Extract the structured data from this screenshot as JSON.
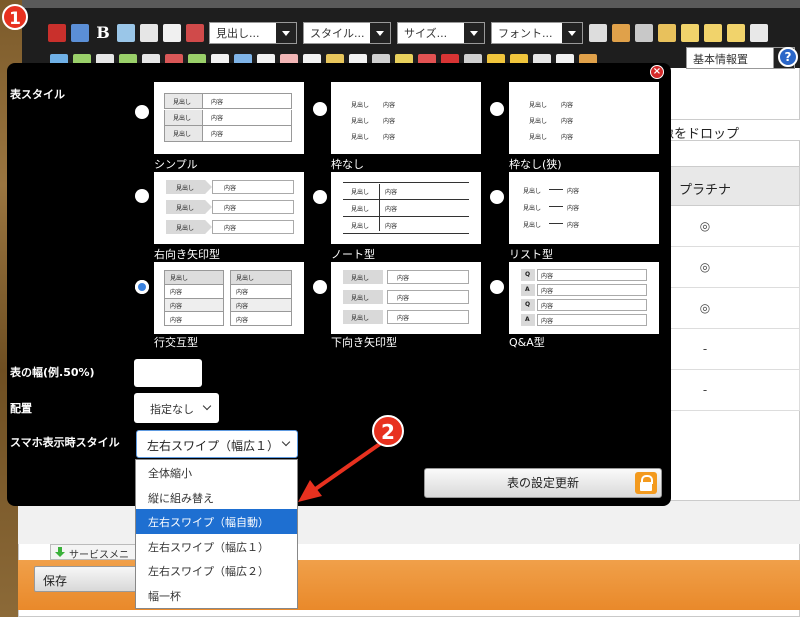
{
  "callouts": {
    "one": "1",
    "two": "2"
  },
  "toolbar": {
    "row1_dropdowns": [
      "見出し...",
      "スタイル...",
      "サイズ...",
      "フォント..."
    ],
    "info_dropdown": "基本情報置",
    "help": "?"
  },
  "background": {
    "drop_text": "像をドロップ",
    "table_header": "プラチナ",
    "table_cells": [
      "◎",
      "◎",
      "◎",
      "-",
      "-"
    ],
    "service_tab": "サービスメニュー",
    "save_button": "保存"
  },
  "modal": {
    "close": "×",
    "table_style_label": "表スタイル",
    "styles": [
      {
        "caption": "シンプル",
        "selected": false
      },
      {
        "caption": "枠なし",
        "selected": false
      },
      {
        "caption": "枠なし(狭)",
        "selected": false
      },
      {
        "caption": "右向き矢印型",
        "selected": false
      },
      {
        "caption": "ノート型",
        "selected": false
      },
      {
        "caption": "リスト型",
        "selected": false
      },
      {
        "caption": "行交互型",
        "selected": true
      },
      {
        "caption": "下向き矢印型",
        "selected": false
      },
      {
        "caption": "Q&A型",
        "selected": false
      }
    ],
    "thumb_text": {
      "heading": "見出し",
      "content": "内容",
      "q": "Q",
      "a": "A"
    },
    "width_label": "表の幅(例.50%)",
    "width_value": "",
    "align_label": "配置",
    "align_value": "指定なし",
    "sp_style_label": "スマホ表示時スタイル",
    "sp_style_value": "左右スワイプ（幅広１）",
    "update_button": "表の設定更新",
    "sp_options": [
      {
        "label": "全体縮小",
        "highlighted": false
      },
      {
        "label": "縦に組み替え",
        "highlighted": false
      },
      {
        "label": "左右スワイプ（幅自動）",
        "highlighted": true
      },
      {
        "label": "左右スワイプ（幅広１）",
        "highlighted": false
      },
      {
        "label": "左右スワイプ（幅広２）",
        "highlighted": false
      },
      {
        "label": "幅一杯",
        "highlighted": false
      }
    ]
  },
  "colors": {
    "accent": "#1e6fd1",
    "callout": "#e8311f",
    "orange": "#e9892a"
  }
}
